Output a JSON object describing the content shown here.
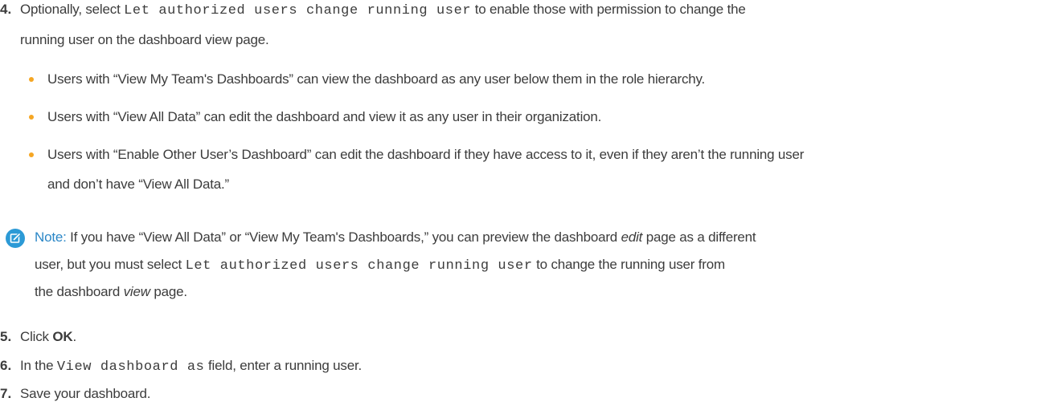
{
  "step4": {
    "number": "4.",
    "text_before": "Optionally, select ",
    "code": "Let authorized users change running user",
    "text_after": " to enable those with permission to change the",
    "continuation": "running user on the dashboard view page."
  },
  "bullets": [
    "Users with “View My Team's Dashboards” can view the dashboard as any user below them in the role hierarchy.",
    "Users with “View All Data” can edit the dashboard and view it as any user in their organization.",
    "Users with “Enable Other User’s Dashboard” can edit the dashboard if they have access to it, even if they aren’t the running user"
  ],
  "bullet3_continuation": "and don’t have “View All Data.”",
  "note": {
    "icon": "edit-icon",
    "label": "Note:",
    "line1_before": " If you have “View All Data” or “View My Team's Dashboards,” you can preview the dashboard ",
    "line1_em": "edit",
    "line1_after": " page as a different",
    "line2_before": "user, but you must select ",
    "line2_code": "Let authorized users change running user",
    "line2_after": " to change the running user from",
    "line3_before": "the dashboard ",
    "line3_em": "view",
    "line3_after": " page."
  },
  "step5": {
    "number": "5.",
    "before": "Click ",
    "bold": "OK",
    "after": "."
  },
  "step6": {
    "number": "6.",
    "before": "In the ",
    "code": "View dashboard as",
    "after": " field, enter a running user."
  },
  "step7": {
    "number": "7.",
    "text": "Save your dashboard."
  },
  "colors": {
    "bullet": "#f5a623",
    "note_icon": "#2c9ad6",
    "note_label": "#2b87c7"
  }
}
